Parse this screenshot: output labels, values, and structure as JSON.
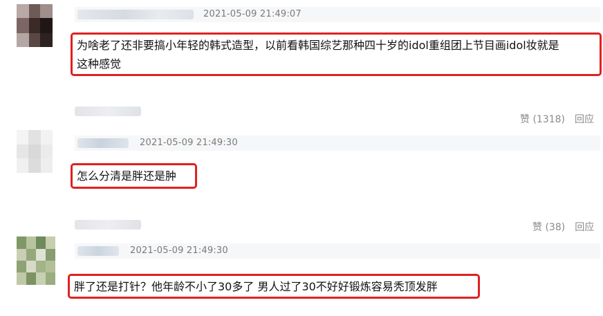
{
  "comments": [
    {
      "timestamp": "2021-05-09 21:49:07",
      "text_line1": "为啥老了还非要搞小年轻的韩式造型，以前看韩国综艺那种四十岁的idol重组团上节目画idol妆就是",
      "text_line2": "这种感觉",
      "like_label": "赞",
      "like_count": "(1318)",
      "reply_label": "回应"
    },
    {
      "timestamp": "2021-05-09 21:49:30",
      "text": "怎么分清是胖还是肿",
      "like_label": "赞",
      "like_count": "(38)",
      "reply_label": "回应"
    },
    {
      "timestamp": "2021-05-09 21:49:30",
      "text": "胖了还是打针？他年龄不小了30多了 男人过了30不好好锻炼容易秃顶发胖"
    }
  ],
  "colors": {
    "highlight_border": "#e02020",
    "meta_background": "#f6f7f9",
    "timestamp_text": "#7a7a7a",
    "action_text": "#8a8a8a"
  },
  "icons": [
    "avatar-pixelated"
  ]
}
